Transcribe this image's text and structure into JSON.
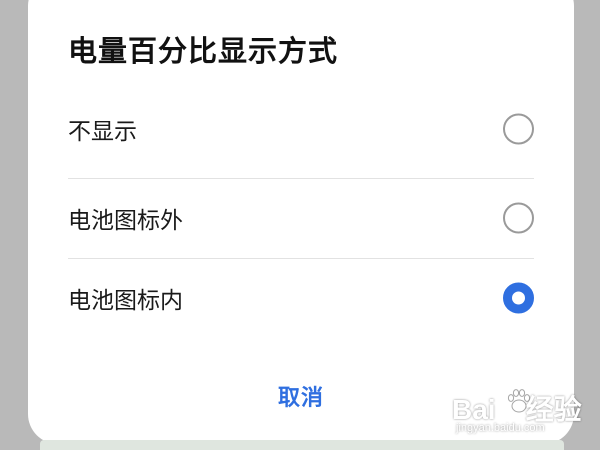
{
  "dialog": {
    "title": "电量百分比显示方式",
    "options": [
      {
        "label": "不显示",
        "selected": false
      },
      {
        "label": "电池图标外",
        "selected": false
      },
      {
        "label": "电池图标内",
        "selected": true
      }
    ],
    "cancel_label": "取消"
  },
  "watermark": {
    "brand_left": "Bai",
    "brand_right": "经验",
    "url": "jingyan.baidu.com"
  },
  "colors": {
    "accent": "#2f6fe0",
    "dialog_bg": "#ffffff",
    "backdrop": "#b9b9b9"
  }
}
